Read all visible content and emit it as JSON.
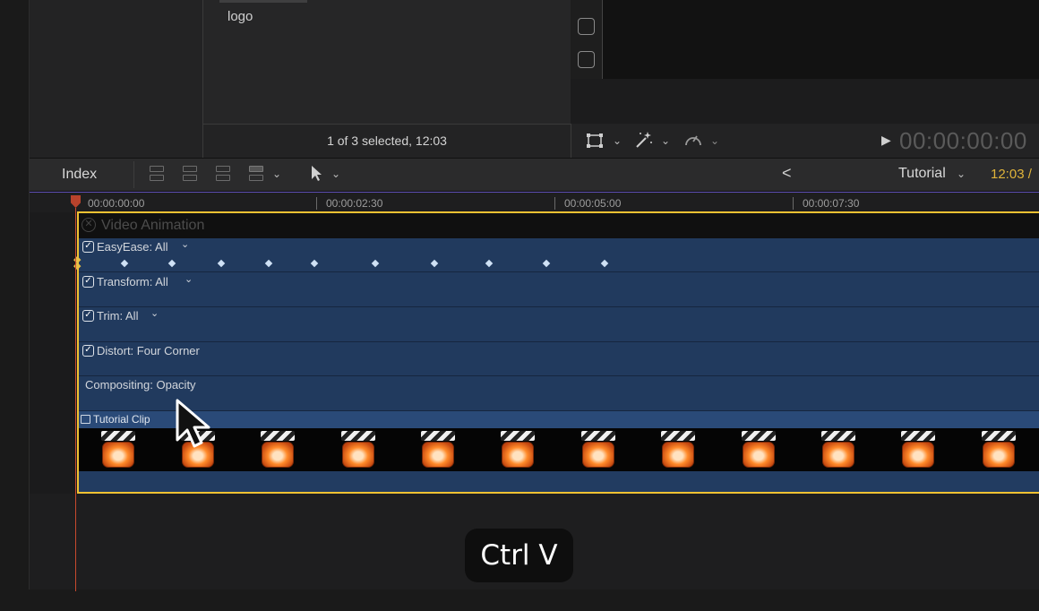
{
  "browser": {
    "item_label": "logo",
    "selection_status": "1 of 3 selected, 12:03"
  },
  "viewer": {
    "timecode": "00:00:00:00",
    "transform_icon": "transform-icon",
    "enhance_icon": "magic-wand-icon",
    "speed_icon": "speed-gauge-icon"
  },
  "timeline_toolbar": {
    "index_label": "Index",
    "project_name": "Tutorial",
    "project_duration": "12:03 /",
    "back_label": "<"
  },
  "ruler": {
    "ticks": [
      "00:00:00:00",
      "00:00:02:30",
      "00:00:05:00",
      "00:00:07:30"
    ]
  },
  "video_animation": {
    "title": "Video Animation",
    "lanes": [
      {
        "label": "EasyEase: All",
        "checked": true,
        "has_menu": true
      },
      {
        "label": "Transform: All",
        "checked": true,
        "has_menu": true
      },
      {
        "label": "Trim: All",
        "checked": true,
        "has_menu": true
      },
      {
        "label": "Distort: Four Corner",
        "checked": true,
        "has_menu": false
      },
      {
        "label": "Compositing: Opacity",
        "checked": false,
        "has_menu": false
      }
    ]
  },
  "clip": {
    "name": "Tutorial Clip",
    "thumbnail_icon": "clapperboard-icon",
    "thumbnail_count": 12
  },
  "keystroke_overlay": "Ctrl V",
  "colors": {
    "selection_border": "#f2c232",
    "lane_blue": "#213a5e",
    "playhead": "#c9492e",
    "duration_yellow": "#e0b43a"
  }
}
